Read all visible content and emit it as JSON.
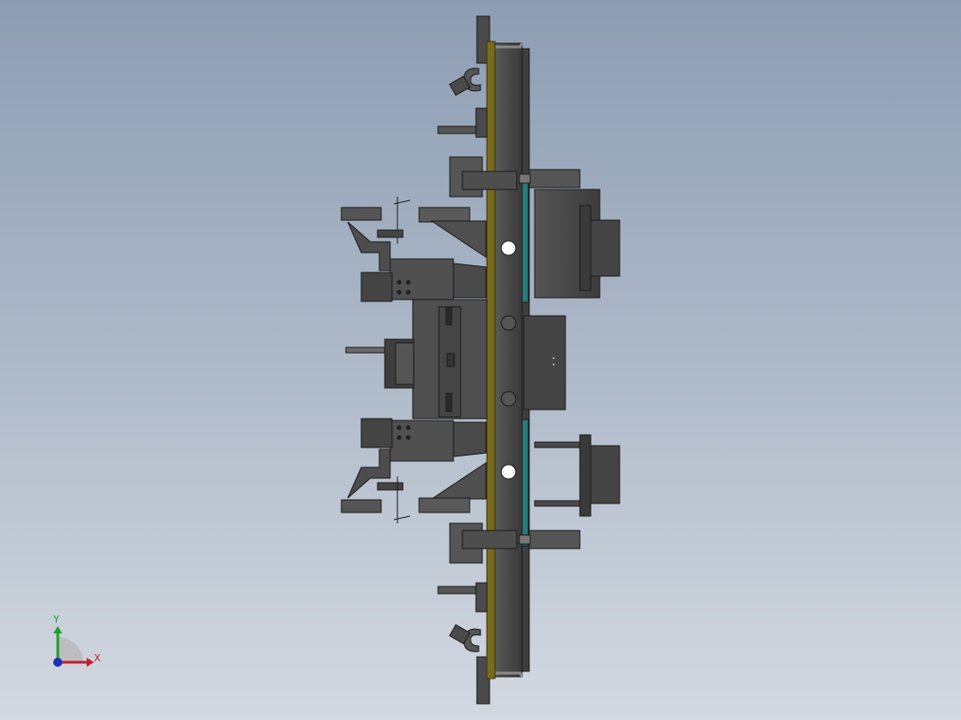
{
  "viewport": {
    "background_top": "#8d9db3",
    "background_bottom": "#d3d9e1"
  },
  "model": {
    "colors": {
      "steel": "#4b4b4b",
      "steel_dark": "#2f2f2f",
      "steel_light": "#6e6e6e",
      "brass": "#7a6a1c",
      "teal": "#2a7b7c",
      "hole": "#ffffff"
    }
  },
  "triad": {
    "x_label": "X",
    "y_label": "Y",
    "x_color": "#c0202a",
    "y_color": "#1f9e2e",
    "z_color": "#1f2fb8"
  }
}
